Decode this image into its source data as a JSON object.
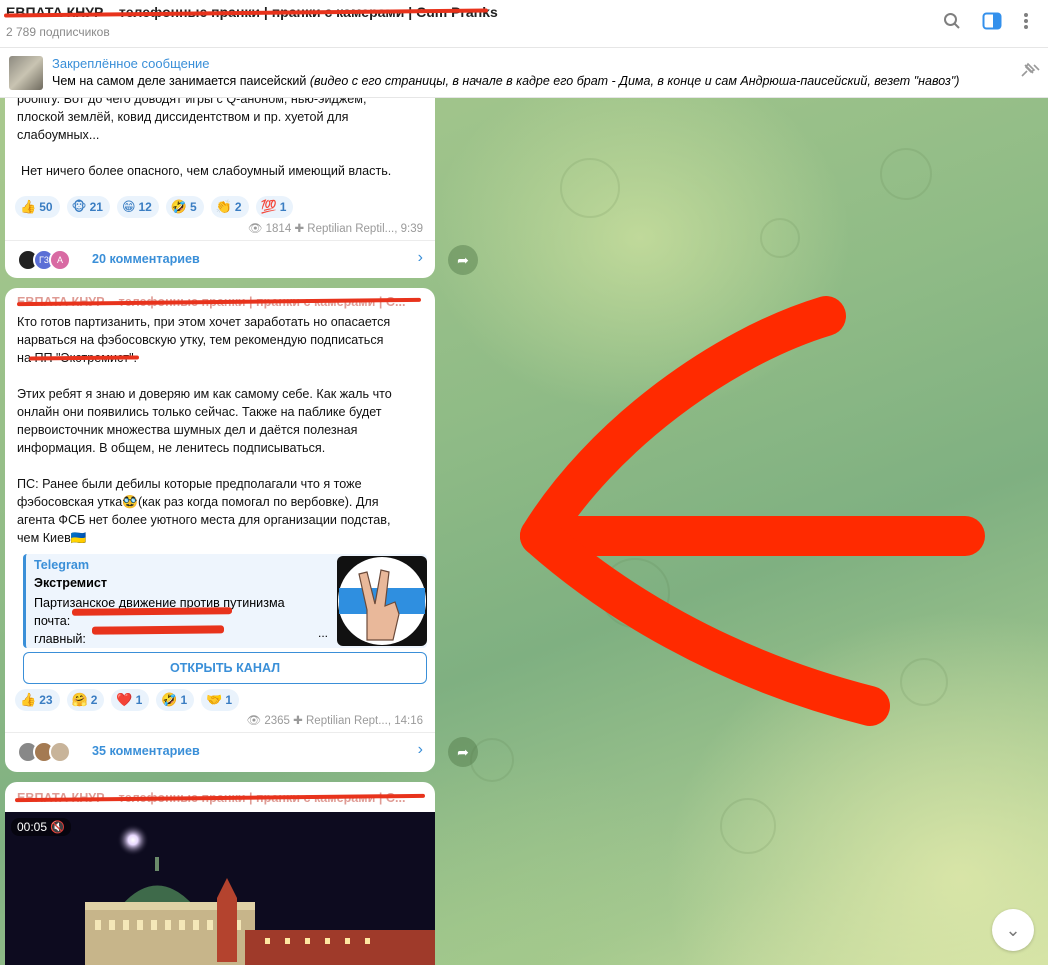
{
  "header": {
    "channel_title": "ЕВПАТА КНУР – телефонные пранки | пранки с камерами | Cum Pranks",
    "subscribers": "2 789 подписчиков"
  },
  "pinned": {
    "label": "Закреплённое сообщение",
    "text": "Чем на самом деле занимается паисейский",
    "italic": "(видео с его страницы, в начале в кадре его брат - Дима, в конце и сам Андрюша-паисейский, везет \"навоз\")"
  },
  "post1": {
    "lines": [
      "poolitry. Вот до чего доводят игры с Q-аноном, нью-эйджем,",
      "плоской землёй, ковид диссидентством и пр. хуетой для",
      "слабоумных...",
      "",
      "Нет ничего более опасного, чем слабоумный имеющий власть."
    ],
    "reactions": [
      {
        "emoji": "👍",
        "count": "50"
      },
      {
        "emoji": "🐵",
        "count": "21"
      },
      {
        "emoji": "😁",
        "count": "12"
      },
      {
        "emoji": "🤣",
        "count": "5"
      },
      {
        "emoji": "👏",
        "count": "2"
      },
      {
        "emoji": "💯",
        "count": "1"
      }
    ],
    "views": "1814",
    "author": "Reptilian Reptil...",
    "time": "9:39",
    "comments": "20 комментариев",
    "avatars": [
      "",
      "Г3",
      "А"
    ]
  },
  "post2": {
    "source": "ЕВПАТА КНУР – телефонные пранки | пранки с камерами | C...",
    "lines": [
      "Кто готов партизанить, при этом хочет заработать но опасается",
      "нарваться на фэбосовскую утку, тем рекомендую подписаться",
      "на ПП \"Экстремист\".",
      "",
      " Этих ребят я знаю и доверяю им как самому себе. Как жаль что",
      "онлайн они появились только сейчас. Также на паблике будет",
      "первоисточник множества шумных дел и даётся полезная",
      "информация. В общем, не ленитесь подписываться.",
      "",
      "ПС: Ранее были дебилы которые предполагали что я тоже",
      "фэбосовская утка🥸(как раз когда помогал по вербовке). Для",
      "агента ФСБ нет более уютного места для организации подстав,",
      "чем Киев🇺🇦"
    ],
    "preview": {
      "site": "Telegram",
      "title": "Экстремист",
      "desc": [
        "Партизанское движение против путинизма",
        "почта:",
        "главный:"
      ],
      "ellipsis": "..."
    },
    "open_button": "ОТКРЫТЬ КАНАЛ",
    "reactions": [
      {
        "emoji": "👍",
        "count": "23"
      },
      {
        "emoji": "🤗",
        "count": "2"
      },
      {
        "emoji": "❤️",
        "count": "1"
      },
      {
        "emoji": "🤣",
        "count": "1"
      },
      {
        "emoji": "🤝",
        "count": "1"
      }
    ],
    "views": "2365",
    "author": "Reptilian Rept...",
    "time": "14:16",
    "comments": "35 комментариев"
  },
  "post3": {
    "source": "ЕВПАТА КНУР – телефонные пранки | пранки с камерами | С...",
    "video_time": "00:05"
  },
  "colors": {
    "accent": "#3a8fd8",
    "redaction": "#e8331c",
    "arrow": "#ff2a00"
  }
}
